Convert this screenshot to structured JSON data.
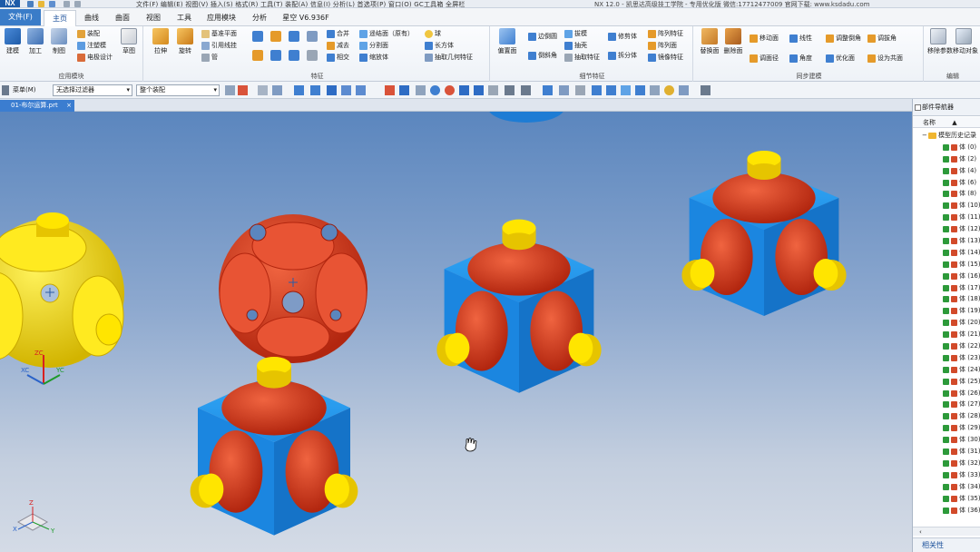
{
  "title_bar": {
    "logo": "NX",
    "menus": "文件(F)  编辑(E)  视图(V)  插入(S)  格式(R)  工具(T)  装配(A)  信息(I)  分析(L)  首选项(P)  窗口(O)  GC工具箱  全屏栏",
    "window_title": "NX 12.0 - 凯思达高级技工学院 - 专用优化版 微信:17712477009  官网下载: www.ksdadu.com"
  },
  "ribbon_tabs": {
    "file": "文件(F)",
    "tabs": [
      "主页",
      "曲线",
      "曲面",
      "视图",
      "工具",
      "应用模块",
      "分析",
      "星空 V6.936F"
    ],
    "active": "主页"
  },
  "ribbon": {
    "app_group": {
      "label": "应用模块",
      "big": [
        "建模",
        "加工",
        "制图"
      ],
      "small": [
        "装配",
        "注塑模",
        "电极设计"
      ],
      "sketch": "草图"
    },
    "feature_group": {
      "label": "特征",
      "big": [
        "拉伸",
        "旋转"
      ],
      "small": [
        "基准平面",
        "引用线挂",
        "管"
      ],
      "small2": [
        "合并",
        "减去",
        "相交"
      ],
      "small3": [
        "遥结面（原有）",
        "分割面",
        "缩放体"
      ],
      "small4": [
        "球",
        "长方体",
        "抽取几何特征"
      ]
    },
    "detail_group": {
      "label": "细节特征",
      "big": [
        "偏置面",
        "边倒圆",
        "倒斜角",
        "抽壳"
      ],
      "small": [
        "拔模",
        "抽壳",
        "抽取特征"
      ],
      "small2": [
        "修剪体",
        "拆分体"
      ],
      "small3": [
        "阵列特征",
        "阵列面",
        "镜像特征"
      ]
    },
    "sync_group": {
      "label": "同步建模",
      "items": [
        "替换面",
        "删除面",
        "移动面",
        "线性",
        "调整倒角",
        "调拔角",
        "调面径",
        "角度",
        "优化面",
        "设为共面"
      ]
    },
    "edit_group": {
      "label": "编辑",
      "items": [
        "移除参数",
        "移动对象"
      ]
    }
  },
  "command_bar": {
    "menu_label": "菜单(M)",
    "filter": "无选择过滤器",
    "scope": "整个装配"
  },
  "doc_tab": {
    "name": "01-布尔运算.prt",
    "close": "×"
  },
  "viewport": {
    "csys_labels": [
      "XC",
      "YC",
      "ZC"
    ],
    "triad_labels": [
      "X",
      "Y",
      "Z"
    ],
    "colors": {
      "cube": "#1e8ee6",
      "sphere_red": "#d93a22",
      "sphere_yellow": "#f0d600",
      "bg_top": "#5b86be",
      "bg_bottom": "#d4dbe6"
    }
  },
  "part_navigator": {
    "title": "部件导航器",
    "col_name": "名称",
    "sort": "▲",
    "root": "模型历史记录",
    "items": [
      "体 (0)",
      "体 (2)",
      "体 (4)",
      "体 (6)",
      "体 (8)",
      "体 (10)",
      "体 (11)",
      "体 (12)",
      "体 (13)",
      "体 (14)",
      "体 (15)",
      "体 (16)",
      "体 (17)",
      "体 (18)",
      "体 (19)",
      "体 (20)",
      "体 (21)",
      "体 (22)",
      "体 (23)",
      "体 (24)",
      "体 (25)",
      "体 (26)",
      "体 (27)",
      "体 (28)",
      "体 (29)",
      "体 (30)",
      "体 (31)",
      "体 (32)",
      "体 (33)",
      "体 (34)",
      "体 (35)",
      "体 (36)"
    ],
    "related": "相关性"
  }
}
